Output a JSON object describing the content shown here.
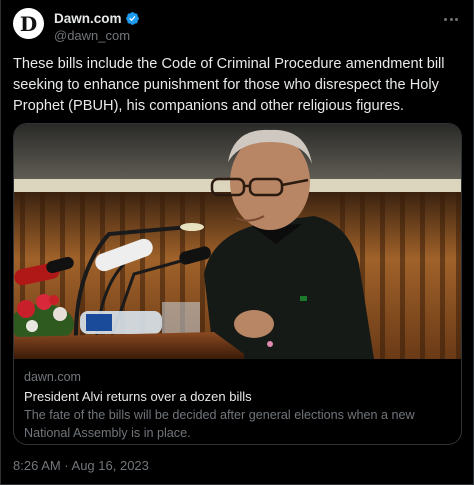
{
  "account": {
    "display_name": "Dawn.com",
    "handle": "@dawn_com",
    "avatar_letter": "D",
    "verified_color": "#1d9bf0"
  },
  "tweet": {
    "text": "These bills include the Code of Criminal Procedure amendment bill seeking to enhance punishment for those who disrespect the Holy Prophet (PBUH), his companions and other religious figures.",
    "timestamp": "8:26 AM · Aug 16, 2023"
  },
  "link_card": {
    "domain": "dawn.com",
    "title": "President Alvi returns over a dozen bills",
    "description": "The fate of the bills will be decided after general elections when a new National Assembly is in place."
  },
  "icons": {
    "more": "more-options-icon",
    "verified": "verified-badge-icon"
  },
  "colors": {
    "background": "#000000",
    "text_primary": "#e7e9ea",
    "text_secondary": "#71767b",
    "border": "#2f3336"
  }
}
